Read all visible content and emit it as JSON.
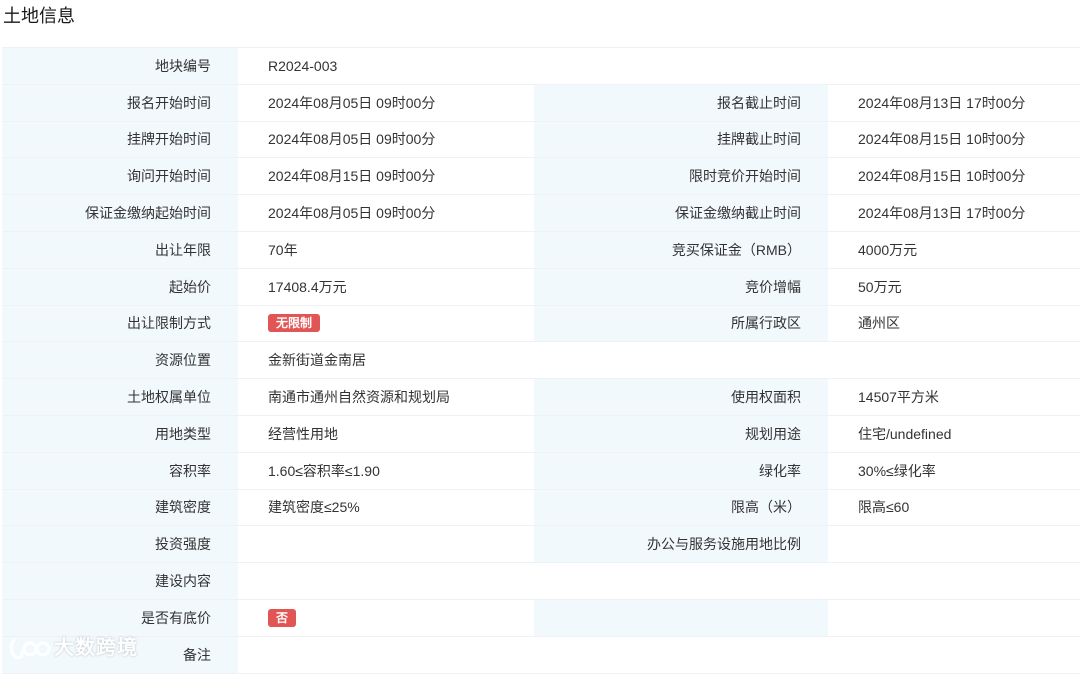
{
  "page": {
    "title": "土地信息"
  },
  "badge_color": "#e25555",
  "label_bg": "#f2f9fd",
  "rows": [
    {
      "l1": "地块编号",
      "v1": "R2024-003"
    },
    {
      "l1": "报名开始时间",
      "v1": "2024年08月05日 09时00分",
      "l2": "报名截止时间",
      "v2": "2024年08月13日 17时00分"
    },
    {
      "l1": "挂牌开始时间",
      "v1": "2024年08月05日 09时00分",
      "l2": "挂牌截止时间",
      "v2": "2024年08月15日 10时00分"
    },
    {
      "l1": "询问开始时间",
      "v1": "2024年08月15日 09时00分",
      "l2": "限时竞价开始时间",
      "v2": "2024年08月15日 10时00分"
    },
    {
      "l1": "保证金缴纳起始时间",
      "v1": "2024年08月05日 09时00分",
      "l2": "保证金缴纳截止时间",
      "v2": "2024年08月13日 17时00分"
    },
    {
      "l1": "出让年限",
      "v1": "70年",
      "l2": "竞买保证金（RMB）",
      "v2": "4000万元"
    },
    {
      "l1": "起始价",
      "v1": "17408.4万元",
      "l2": "竞价增幅",
      "v2": "50万元"
    },
    {
      "l1": "出让限制方式",
      "v1": "无限制",
      "l2": "所属行政区",
      "v2": "通州区"
    },
    {
      "l1": "资源位置",
      "v1": "金新街道金南居"
    },
    {
      "l1": "土地权属单位",
      "v1": "南通市通州自然资源和规划局",
      "l2": "使用权面积",
      "v2": "14507平方米"
    },
    {
      "l1": "用地类型",
      "v1": "经营性用地",
      "l2": "规划用途",
      "v2": "住宅/undefined"
    },
    {
      "l1": "容积率",
      "v1": "1.60≤容积率≤1.90",
      "l2": "绿化率",
      "v2": "30%≤绿化率"
    },
    {
      "l1": "建筑密度",
      "v1": "建筑密度≤25%",
      "l2": "限高（米）",
      "v2": "限高≤60"
    },
    {
      "l1": "投资强度",
      "v1": "",
      "l2": "办公与服务设施用地比例",
      "v2": ""
    },
    {
      "l1": "建设内容",
      "v1": ""
    },
    {
      "l1": "是否有底价",
      "v1": "否",
      "l2": "",
      "v2": ""
    },
    {
      "l1": "备注",
      "v1": ""
    }
  ],
  "watermark": {
    "text": "大数跨境",
    "icon": "brand-logo-icon"
  }
}
